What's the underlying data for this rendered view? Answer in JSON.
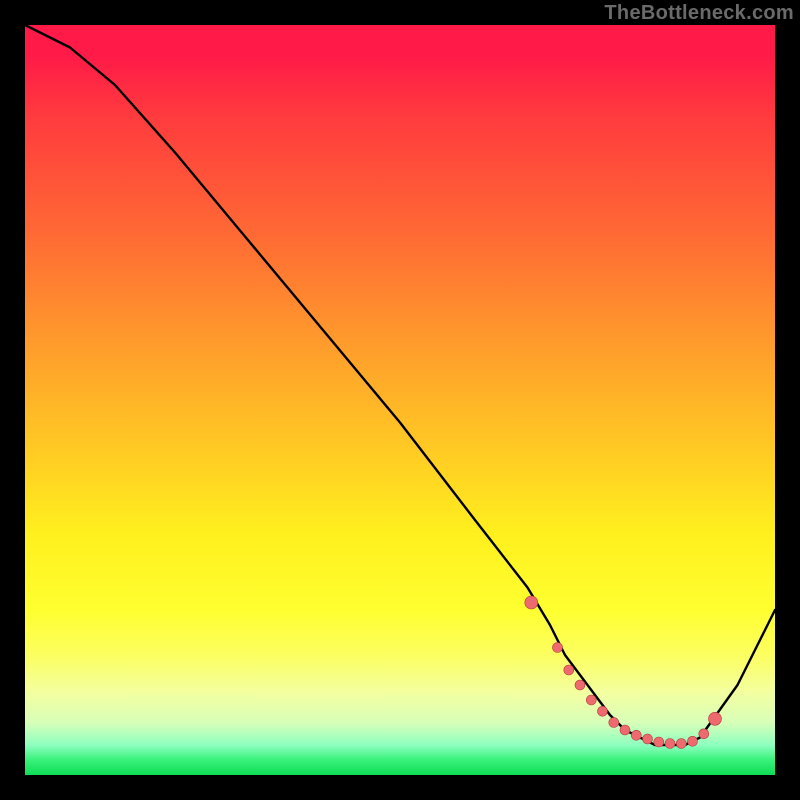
{
  "watermark": "TheBottleneck.com",
  "colors": {
    "gradient_top": "#ff1a48",
    "gradient_bottom": "#0fdc55",
    "curve_stroke": "#000000",
    "marker_fill": "#ed6b6e",
    "marker_stroke": "#b23a3d",
    "frame_bg": "#000000"
  },
  "chart_data": {
    "type": "line",
    "title": "",
    "xlabel": "",
    "ylabel": "",
    "xlim": [
      0,
      100
    ],
    "ylim": [
      0,
      100
    ],
    "grid": false,
    "legend": false,
    "series": [
      {
        "name": "bottleneck-curve",
        "x": [
          0,
          6,
          12,
          20,
          30,
          40,
          50,
          60,
          67,
          70,
          72,
          75,
          78,
          80,
          82,
          84,
          86,
          88,
          90,
          95,
          100
        ],
        "values": [
          100,
          97,
          92,
          83,
          71,
          59,
          47,
          34,
          25,
          20,
          16,
          12,
          8,
          6,
          5,
          4,
          4,
          4,
          5,
          12,
          22
        ]
      }
    ],
    "markers": {
      "name": "highlight-dots",
      "x": [
        67.5,
        71.0,
        72.5,
        74.0,
        75.5,
        77.0,
        78.5,
        80.0,
        81.5,
        83.0,
        84.5,
        86.0,
        87.5,
        89.0,
        90.5,
        92.0
      ],
      "values": [
        23.0,
        17.0,
        14.0,
        12.0,
        10.0,
        8.5,
        7.0,
        6.0,
        5.3,
        4.8,
        4.4,
        4.2,
        4.2,
        4.5,
        5.5,
        7.5
      ]
    }
  }
}
